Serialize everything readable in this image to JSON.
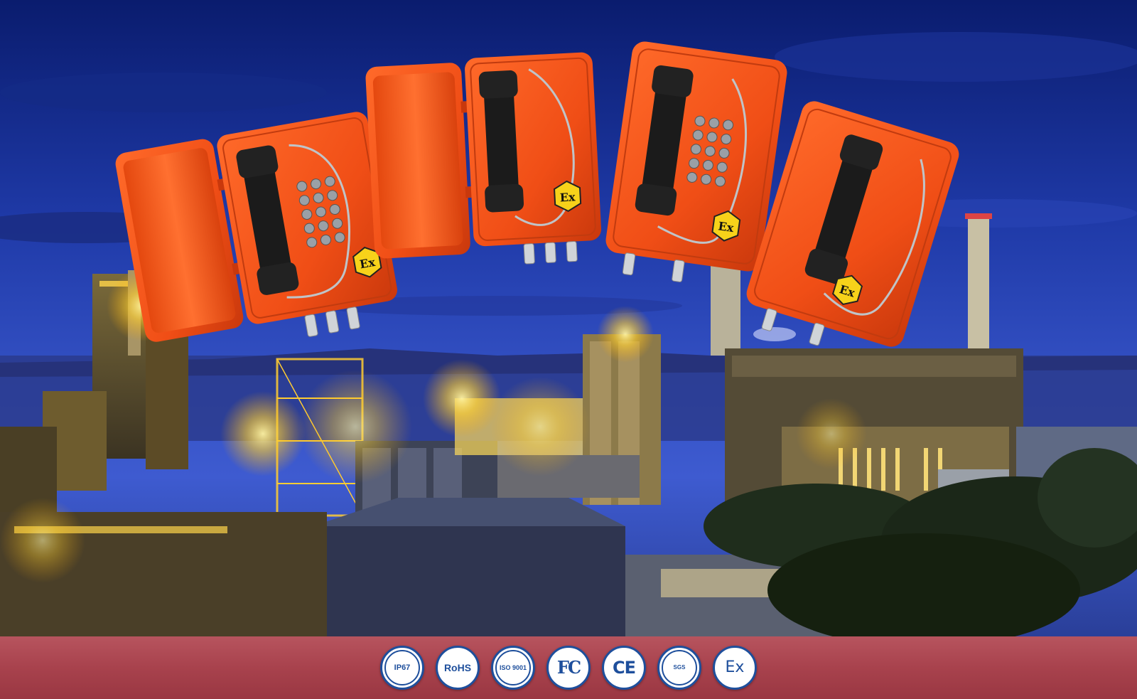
{
  "scene": {
    "description_colors": {
      "sky_top": "#0c1f78",
      "sky_mid": "#2541b5",
      "horizon": "#3a55c8",
      "plant_glow": "#ffcf2e",
      "housing_orange": "#f2541b"
    },
    "phones": [
      {
        "variant": "with-door-and-keypad",
        "label": "Ex"
      },
      {
        "variant": "with-door-no-keypad",
        "label": "Ex"
      },
      {
        "variant": "keypad-no-door",
        "label": "Ex"
      },
      {
        "variant": "no-keypad-no-door",
        "label": "Ex"
      }
    ]
  },
  "certifications": [
    {
      "name": "ip67-badge",
      "text": "IP67"
    },
    {
      "name": "rohs-badge",
      "text": "RoHS"
    },
    {
      "name": "iso9001-badge",
      "text": "ISO 9001"
    },
    {
      "name": "fcc-badge",
      "text": "FC"
    },
    {
      "name": "ce-badge",
      "text": "CE"
    },
    {
      "name": "sgs-badge",
      "text": "SGS"
    },
    {
      "name": "ex-badge",
      "text": "Ex"
    }
  ],
  "colors": {
    "bar": "#a8424d",
    "badge_blue": "#1e4f9c",
    "ex_yellow": "#f7d21a"
  }
}
